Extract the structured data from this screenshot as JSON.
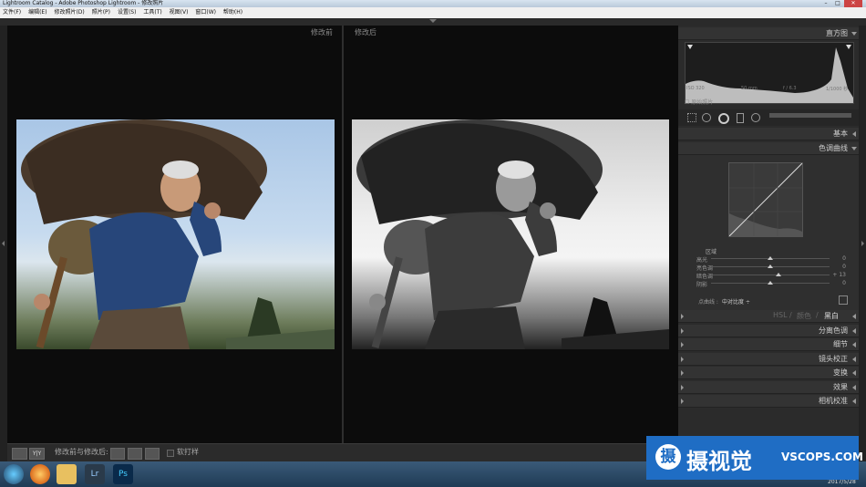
{
  "window": {
    "title": "Lightroom Catalog - Adobe Photoshop Lightroom - 修改照片",
    "minimize": "–",
    "maximize": "□",
    "close": "✕"
  },
  "menu": [
    "文件(F)",
    "编辑(E)",
    "修改照片(D)",
    "照片(P)",
    "设置(S)",
    "工具(T)",
    "视图(V)",
    "窗口(W)",
    "帮助(H)"
  ],
  "viewer": {
    "before_label": "修改前",
    "after_label": "修改后"
  },
  "toolbar": {
    "yy_label": "Y|Y",
    "compare_label": "修改前与修改后:",
    "softproof_label": "软打样"
  },
  "panel": {
    "histogram_title": "直方图",
    "histo_info": [
      "ISO 320",
      "50 mm",
      "f / 6.3",
      "1/1000 秒"
    ],
    "original_photo": "原始照片",
    "basic": "基本",
    "tone_curve": "色调曲线",
    "region": "区域",
    "sliders": [
      {
        "label": "高光",
        "value": "0",
        "pos": 0.5
      },
      {
        "label": "亮色调",
        "value": "0",
        "pos": 0.5
      },
      {
        "label": "暗色调",
        "value": "+ 13",
        "pos": 0.57
      },
      {
        "label": "阴影",
        "value": "0",
        "pos": 0.5
      }
    ],
    "point_curve_label": "点曲线 :",
    "point_curve_value": "中对比度 ÷",
    "hsl": "HSL",
    "color": "颜色",
    "bw": "黑白",
    "split_toning": "分离色调",
    "detail": "细节",
    "lens": "镜头校正",
    "transform": "变换",
    "effects": "效果",
    "camera_calib": "相机校准"
  },
  "watermark": {
    "logo": "摄",
    "text": "摄视觉",
    "url": "VSCOPS.COM"
  },
  "taskbar": {
    "date": "2017/5/28"
  }
}
